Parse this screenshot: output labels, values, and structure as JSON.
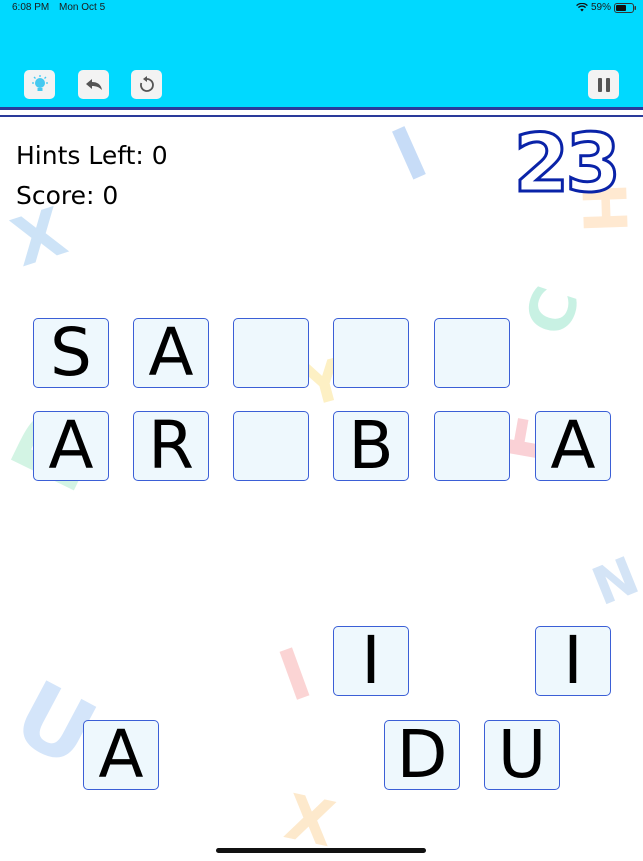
{
  "status_bar": {
    "time": "6:08 PM",
    "date": "Mon Oct 5",
    "battery": "59%",
    "icons": [
      "wifi-icon",
      "battery-icon"
    ]
  },
  "toolbar": {
    "buttons": [
      "lightbulb-icon",
      "undo-icon",
      "restart-icon",
      "pause-icon"
    ]
  },
  "hud": {
    "hints_label": "Hints Left: 0",
    "score_label": "Score: 0",
    "timer": "23"
  },
  "board": {
    "row1": [
      "S",
      "A",
      "",
      "",
      ""
    ],
    "row2": [
      "A",
      "R",
      "",
      "B",
      "",
      "A"
    ]
  },
  "letter_pool": [
    "I",
    "I",
    "A",
    "D",
    "U"
  ],
  "background_letters": [
    "I",
    "H",
    "X",
    "C",
    "Y",
    "E",
    "D",
    "N",
    "I",
    "U",
    "X"
  ],
  "colors": {
    "header": "#00d9ff",
    "tile_bg": "#eef8fd",
    "tile_border": "#3b5fd6",
    "timer_outline": "#0a23a8"
  }
}
